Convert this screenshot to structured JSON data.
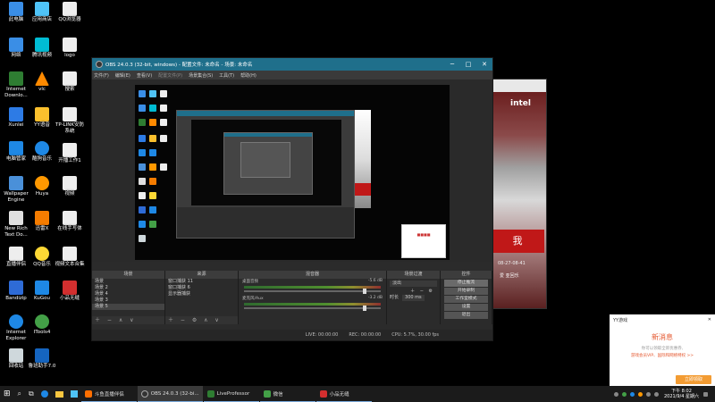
{
  "desktop": {
    "icons": [
      {
        "label": "此电脑",
        "color": "#3a8ee6"
      },
      {
        "label": "网络",
        "color": "#3a8ee6"
      },
      {
        "label": "Internet Downlo...",
        "color": "#2e7d32"
      },
      {
        "label": "Xunlei",
        "color": "#2d7be5"
      },
      {
        "label": "电脑管家",
        "color": "#1e88e5"
      },
      {
        "label": "Wallpaper Engine",
        "color": "#4a90d9"
      },
      {
        "label": "New Rich Text Do...",
        "color": "#e0e0e0"
      },
      {
        "label": "直播伴侣",
        "color": "#eeeeee"
      },
      {
        "label": "Bandizip",
        "color": "#2e6bd6"
      },
      {
        "label": "Internet Explorer",
        "color": "#1e88e5"
      },
      {
        "label": "回收站",
        "color": "#cfd8dc"
      },
      {
        "label": "应用商店",
        "color": "#4fc3f7"
      },
      {
        "label": "腾讯视频",
        "color": "#00bcd4"
      },
      {
        "label": "vlc",
        "color": "#ff8a00"
      },
      {
        "label": "YY语音",
        "color": "#fbc02d"
      },
      {
        "label": "酷狗音乐",
        "color": "#1e88e5"
      },
      {
        "label": "Huya",
        "color": "#ff9800"
      },
      {
        "label": "迅雷X",
        "color": "#f57c00"
      },
      {
        "label": "QQ音乐",
        "color": "#fdd835"
      },
      {
        "label": "KuGou",
        "color": "#1e88e5"
      },
      {
        "label": "ITools4",
        "color": "#43a047"
      },
      {
        "label": "鲁班助手7.0",
        "color": "#1565c0"
      },
      {
        "label": "QQ浏览器",
        "color": "#eeeeee"
      },
      {
        "label": "logo",
        "color": "#eeeeee"
      },
      {
        "label": "搜索",
        "color": "#eeeeee"
      },
      {
        "label": "TP-LINK安防系统",
        "color": "#eeeeee"
      },
      {
        "label": "开播工作1",
        "color": "#eeeeee"
      },
      {
        "label": "视频",
        "color": "#eeeeee"
      },
      {
        "label": "在线手写体",
        "color": "#eeeeee"
      },
      {
        "label": "视频文本合集",
        "color": "#eeeeee"
      },
      {
        "label": "小品无缝",
        "color": "#d32f2f"
      }
    ]
  },
  "background_window": {
    "brand": "intel",
    "red_button_text": "我",
    "date": "08-27-08-41",
    "links": "爱 亚回乐"
  },
  "obs": {
    "title": "OBS 24.0.3 (32-bit, windows) - 配置文件: 未命名 - 场景: 未命名",
    "menu": [
      "文件(F)",
      "编辑(E)",
      "查看(V)",
      "配置文件(P)",
      "场景集合(S)",
      "工具(T)",
      "帮助(H)"
    ],
    "docks": {
      "scenes": {
        "header": "场景",
        "items": [
          "场景",
          "场景 2",
          "场景 4",
          "场景 3",
          "场景 5"
        ]
      },
      "sources": {
        "header": "来源",
        "items": [
          "窗口捕获 11",
          "窗口捕获 6",
          "显示器捕获"
        ]
      },
      "mixer": {
        "header": "混音器",
        "channels": [
          {
            "label": "桌面音频",
            "db": "-5.6 dB"
          },
          {
            "label": "麦克风/Aux",
            "db": "-3.2 dB"
          }
        ]
      },
      "transitions": {
        "header": "场景过渡",
        "type": "淡出",
        "duration_label": "时长",
        "duration_value": "300 ms"
      },
      "controls": {
        "header": "控件",
        "buttons": [
          "停止推流",
          "开始录制",
          "工作室模式",
          "设置",
          "退出"
        ]
      }
    },
    "status": {
      "live": "LIVE: 00:00:00",
      "rec": "REC: 00:00:00",
      "cpu": "CPU: 5.7%, 30.00 fps"
    }
  },
  "notification": {
    "app": "YY游戏",
    "title": "新消息",
    "line1": "你可以领取全新优惠券,",
    "line2": "游戏会员VIP、国际和网络特权 >>",
    "button": "立即领取"
  },
  "taskbar": {
    "apps": [
      {
        "label": "斗鱼直播伴侣",
        "color": "#ff6f00"
      },
      {
        "label": "OBS 24.0.3 (32-bi...",
        "color": "#333333"
      },
      {
        "label": "LiveProfessor",
        "color": "#2e7d32"
      },
      {
        "label": "微信",
        "color": "#43a047"
      },
      {
        "label": "小品无缝",
        "color": "#d32f2f"
      }
    ],
    "time": "下午 8:02",
    "date": "2021/9/4 星期六"
  }
}
